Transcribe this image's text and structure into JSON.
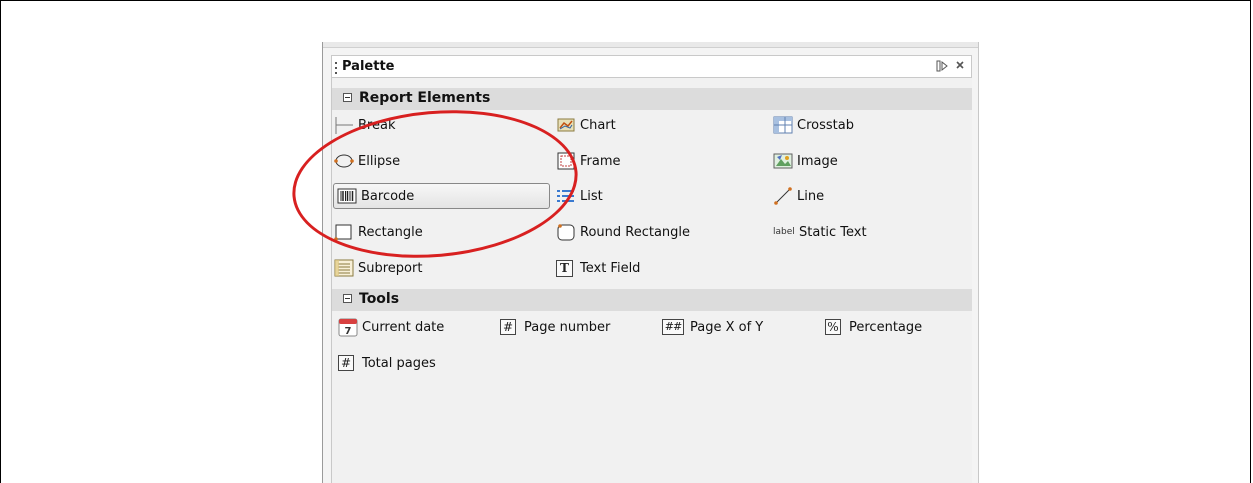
{
  "palette": {
    "title": "Palette",
    "icons": [
      "minimize-icon",
      "close-icon"
    ],
    "sections": [
      {
        "label": "Report Elements",
        "items": [
          {
            "label": "Break",
            "icon": "break-icon"
          },
          {
            "label": "Chart",
            "icon": "chart-icon"
          },
          {
            "label": "Crosstab",
            "icon": "crosstab-icon"
          },
          {
            "label": "Ellipse",
            "icon": "ellipse-icon"
          },
          {
            "label": "Frame",
            "icon": "frame-icon"
          },
          {
            "label": "Image",
            "icon": "image-icon"
          },
          {
            "label": "Barcode",
            "icon": "barcode-icon"
          },
          {
            "label": "List",
            "icon": "list-icon"
          },
          {
            "label": "Line",
            "icon": "line-icon"
          },
          {
            "label": "Rectangle",
            "icon": "rectangle-icon"
          },
          {
            "label": "Round Rectangle",
            "icon": "round-rectangle-icon"
          },
          {
            "label": "Static Text",
            "icon": "static-text-icon",
            "icon_text": "label"
          },
          {
            "label": "Subreport",
            "icon": "subreport-icon"
          },
          {
            "label": "Text Field",
            "icon": "text-field-icon",
            "icon_text": "T"
          }
        ]
      },
      {
        "label": "Tools",
        "items": [
          {
            "label": "Current date",
            "icon": "calendar-icon",
            "icon_text": "7"
          },
          {
            "label": "Page number",
            "icon": "hash-icon",
            "icon_text": "#"
          },
          {
            "label": "Page X of Y",
            "icon": "double-hash-icon",
            "icon_text": "##"
          },
          {
            "label": "Percentage",
            "icon": "percent-icon",
            "icon_text": "%"
          },
          {
            "label": "Total pages",
            "icon": "hash-icon",
            "icon_text": "#"
          }
        ]
      }
    ],
    "selected_item": "Barcode"
  },
  "colors": {
    "highlight_oval": "#d82020",
    "section_bg": "#dcdcdc"
  }
}
